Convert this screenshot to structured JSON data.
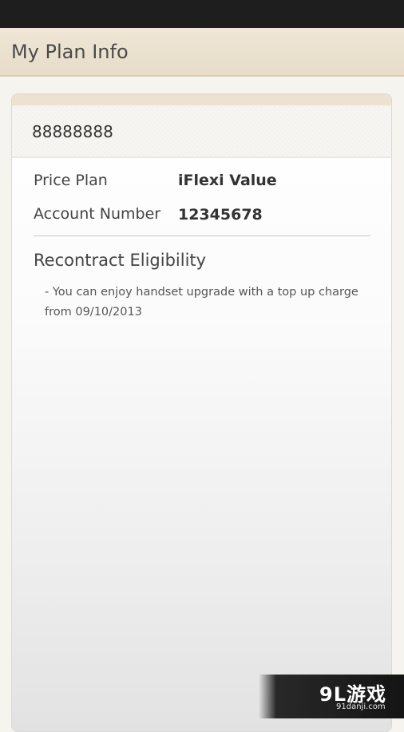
{
  "header": {
    "title": "My Plan Info"
  },
  "plan": {
    "phone_number": "88888888",
    "price_plan_label": "Price Plan",
    "price_plan_value": "iFlexi Value",
    "account_number_label": "Account Number",
    "account_number_value": "12345678"
  },
  "recontract": {
    "title": "Recontract Eligibility",
    "message": "- You can enjoy handset upgrade with a top up charge from 09/10/2013"
  },
  "watermark": {
    "logo": "9L游戏",
    "url": "91danji.com"
  },
  "colors": {
    "status_bar": "#1e1e1e",
    "action_bar": "#e9e0ce",
    "card_background": "#ffffff",
    "text_primary": "#333333"
  }
}
